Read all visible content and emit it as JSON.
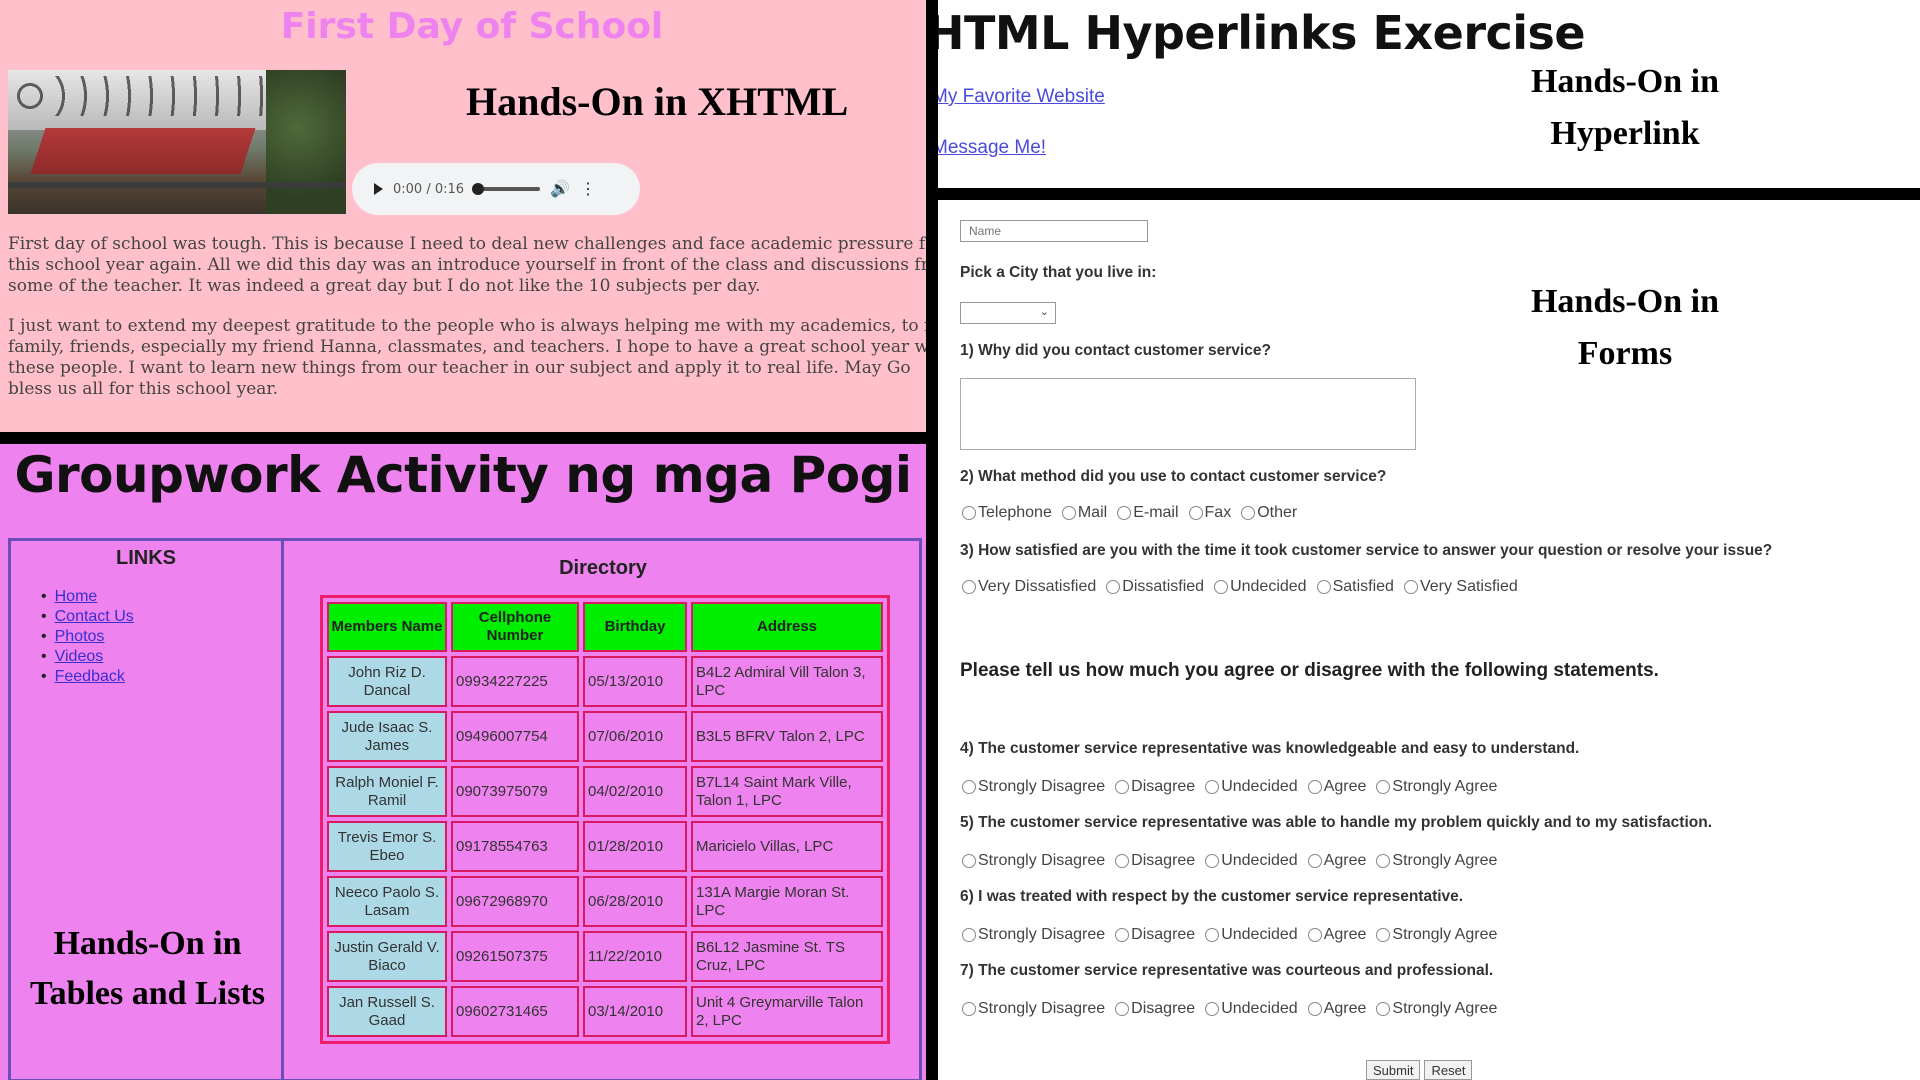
{
  "xhtml": {
    "page_title": "First Day of School",
    "heading": "Hands-On in XHTML",
    "audio": {
      "time": "0:00 / 0:16",
      "progress": 0.0
    },
    "paragraph1": [
      "First day of school was tough. This is because I need to deal new challenges and face academic pressure fo",
      "this school year again. All we did this day was an introduce yourself in front of the class and discussions from",
      "some of the teacher. It was indeed a great day but I do not like the 10 subjects per day."
    ],
    "paragraph2": [
      "I just want to extend my deepest gratitude to the people who is always helping me with my academics, to m",
      "family, friends, especially my friend Hanna, classmates, and teachers. I hope to have a great school year wit",
      "these people. I want to learn new things from our teacher in our subject and apply it to real life. May Go",
      "bless us all for this school year."
    ]
  },
  "hyperlink": {
    "title": "HTML Hyperlinks Exercise",
    "link1": "My Favorite Website",
    "link2": "Message Me!",
    "heading": "Hands-On in Hyperlink",
    "link_color": "#4a4adf"
  },
  "groupwork": {
    "title": "Groupwork Activity ng mga Pogi",
    "links_title": "LINKS",
    "links": [
      "Home",
      "Contact Us",
      "Photos",
      "Videos",
      "Feedback"
    ],
    "heading": "Hands-On in Tables and Lists",
    "directory_title": "Directory",
    "columns": [
      "Members Name",
      "Cellphone Number",
      "Birthday",
      "Address"
    ],
    "rows": [
      [
        "John Riz D. Dancal",
        "09934227225",
        "05/13/2010",
        "B4L2 Admiral Vill Talon 3, LPC"
      ],
      [
        "Jude Isaac S. James",
        "09496007754",
        "07/06/2010",
        "B3L5 BFRV Talon 2, LPC"
      ],
      [
        "Ralph Moniel F. Ramil",
        "09073975079",
        "04/02/2010",
        "B7L14 Saint Mark Ville, Talon 1, LPC"
      ],
      [
        "Trevis Emor S. Ebeo",
        "09178554763",
        "01/28/2010",
        "Maricielo Villas, LPC"
      ],
      [
        "Neeco Paolo S. Lasam",
        "09672968970",
        "06/28/2010",
        "131A Margie Moran St. LPC"
      ],
      [
        "Justin Gerald V. Biaco",
        "09261507375",
        "11/22/2010",
        "B6L12 Jasmine St. TS Cruz, LPC"
      ],
      [
        "Jan Russell S. Gaad",
        "09602731465",
        "03/14/2010",
        "Unit 4 Greymarville Talon 2, LPC"
      ]
    ],
    "header_color": "#00ee00",
    "name_cell_color": "#add8e6"
  },
  "forms": {
    "name_placeholder": "Name",
    "heading": "Hands-On in Forms",
    "q_city": "Pick a City that you live in:",
    "q1": "1) Why did you contact customer service?",
    "q2": "2) What method did you use to contact customer service?",
    "q2_options": [
      "Telephone",
      "Mail",
      "E-mail",
      "Fax",
      "Other"
    ],
    "q3": "3) How satisfied are you with the time it took customer service to answer your question or resolve your issue?",
    "q3_options": [
      "Very Dissatisfied",
      "Dissatisfied",
      "Undecided",
      "Satisfied",
      "Very Satisfied"
    ],
    "subheading": "Please tell us how much you agree or disagree with the following statements.",
    "q4": "4) The customer service representative was knowledgeable and easy to understand.",
    "q5": "5) The customer service representative was able to handle my problem quickly and to my satisfaction.",
    "q6": "6) I was treated with respect by the customer service representative.",
    "q7": "7) The customer service representative was courteous and professional.",
    "agree_options": [
      "Strongly Disagree",
      "Disagree",
      "Undecided",
      "Agree",
      "Strongly Agree"
    ],
    "submit_label": "Submit",
    "reset_label": "Reset"
  }
}
